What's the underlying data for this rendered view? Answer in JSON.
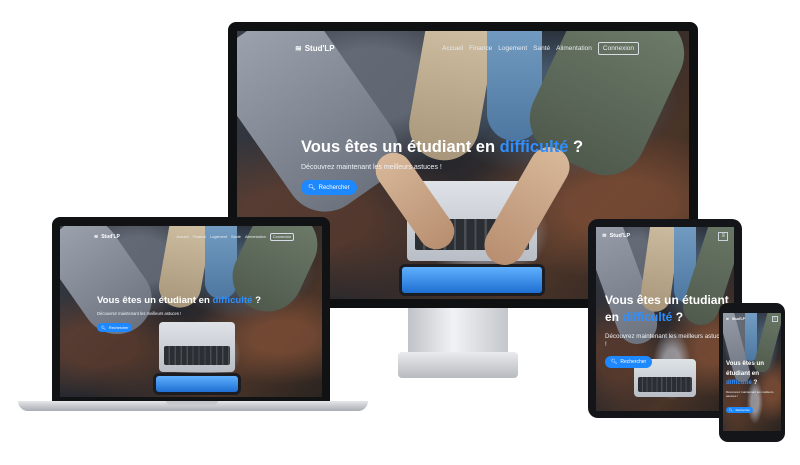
{
  "brand": {
    "name": "Stud'LP"
  },
  "nav": {
    "items": [
      "Accueil",
      "Finance",
      "Logement",
      "Santé",
      "Alimentation"
    ],
    "login": "Connexion",
    "toggler_icon": "hamburger-icon"
  },
  "hero": {
    "title_part1": "Vous êtes un étudiant en",
    "title_accent": "difficulté",
    "title_end": "?",
    "subtitle": "Découvrez maintenant les meilleurs astuces !",
    "button_label": "Rechercher",
    "button_icon": "search-icon"
  },
  "colors": {
    "accent": "#2f8fff",
    "button": "#1e88ff"
  }
}
